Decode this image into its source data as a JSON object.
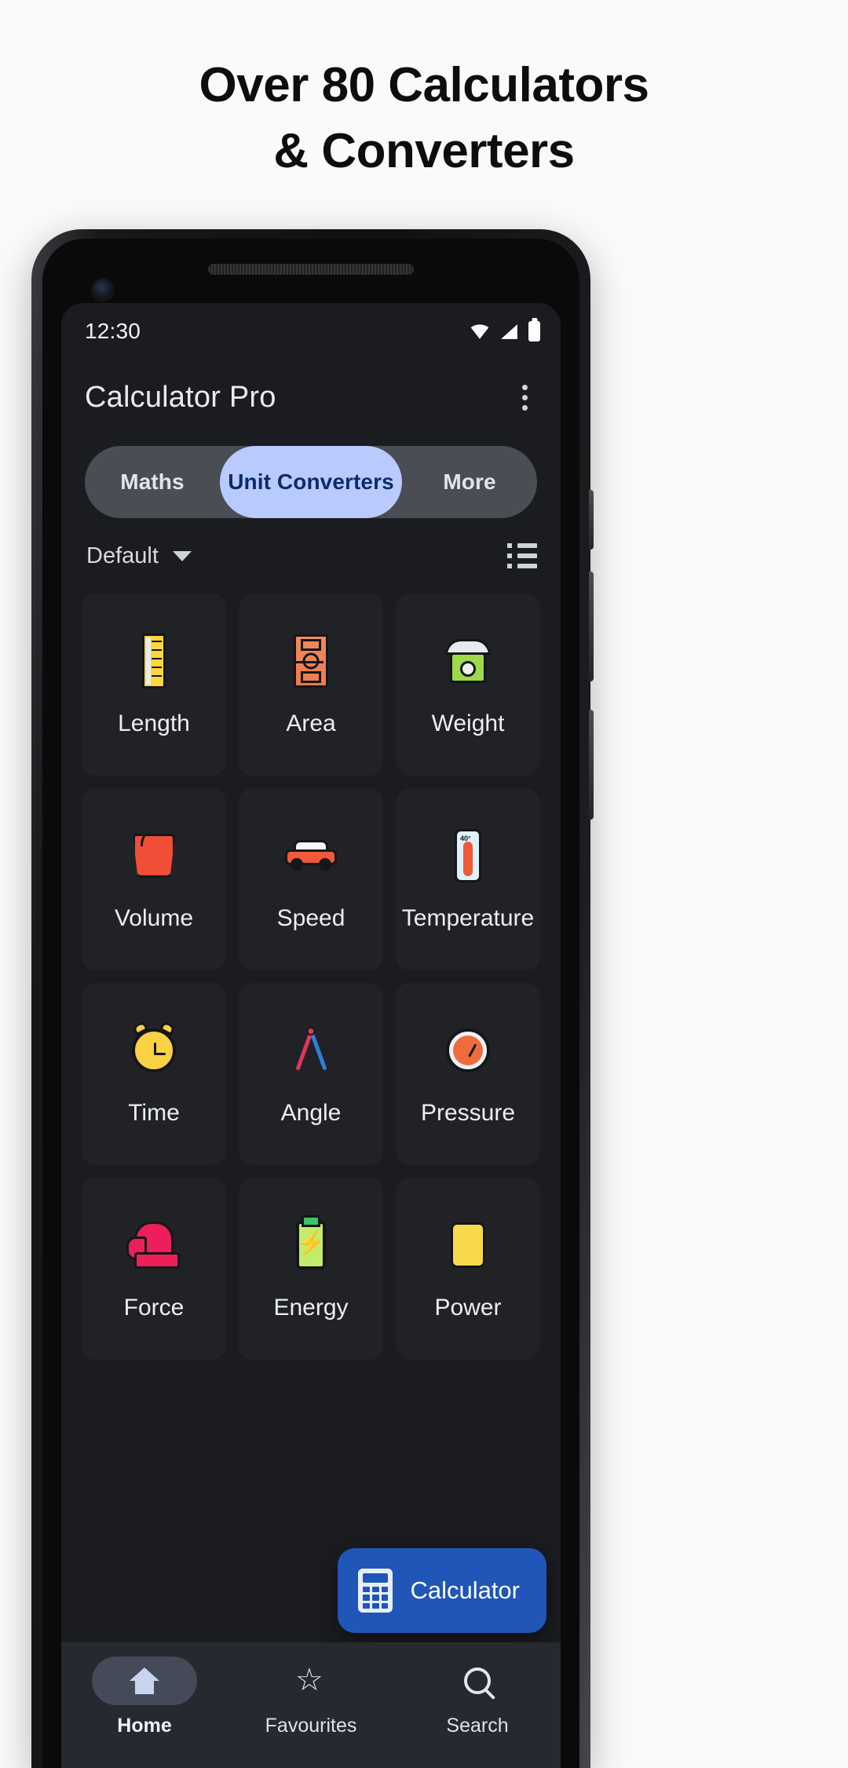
{
  "headline": {
    "line1": "Over 80 Calculators",
    "line2": "& Converters"
  },
  "statusbar": {
    "time": "12:30",
    "icons": [
      "wifi-icon",
      "signal-icon",
      "battery-icon"
    ]
  },
  "appbar": {
    "title": "Calculator Pro",
    "overflow": "overflow-menu-icon"
  },
  "tabs": [
    {
      "label": "Maths",
      "selected": false
    },
    {
      "label": "Unit Converters",
      "selected": true
    },
    {
      "label": "More",
      "selected": false
    }
  ],
  "filter": {
    "label": "Default",
    "caret": "chevron-down-icon",
    "view_toggle": "list-view-icon"
  },
  "grid": {
    "items": [
      {
        "label": "Length",
        "icon": "ruler-icon"
      },
      {
        "label": "Area",
        "icon": "sports-field-icon"
      },
      {
        "label": "Weight",
        "icon": "weighing-scale-icon"
      },
      {
        "label": "Volume",
        "icon": "bucket-icon"
      },
      {
        "label": "Speed",
        "icon": "car-icon"
      },
      {
        "label": "Temperature",
        "icon": "thermometer-icon"
      },
      {
        "label": "Time",
        "icon": "alarm-clock-icon"
      },
      {
        "label": "Angle",
        "icon": "compass-icon"
      },
      {
        "label": "Pressure",
        "icon": "gauge-icon"
      },
      {
        "label": "Force",
        "icon": "boxing-glove-icon"
      },
      {
        "label": "Energy",
        "icon": "battery-bolt-icon"
      },
      {
        "label": "Power",
        "icon": "plug-icon"
      }
    ]
  },
  "fab": {
    "label": "Calculator",
    "icon": "calculator-icon"
  },
  "bottomnav": [
    {
      "label": "Home",
      "icon": "home-icon",
      "selected": true
    },
    {
      "label": "Favourites",
      "icon": "star-icon",
      "selected": false
    },
    {
      "label": "Search",
      "icon": "search-icon",
      "selected": false
    }
  ],
  "colors": {
    "page_bg": "#fafafb",
    "screen_bg": "#1b1c20",
    "card_bg": "#212226",
    "tab_track": "#4b4d55",
    "tab_selected_bg": "#b9caff",
    "tab_selected_text": "#0d2b6b",
    "fab_blue": "#1f56b8",
    "nav_bg": "#272930"
  }
}
